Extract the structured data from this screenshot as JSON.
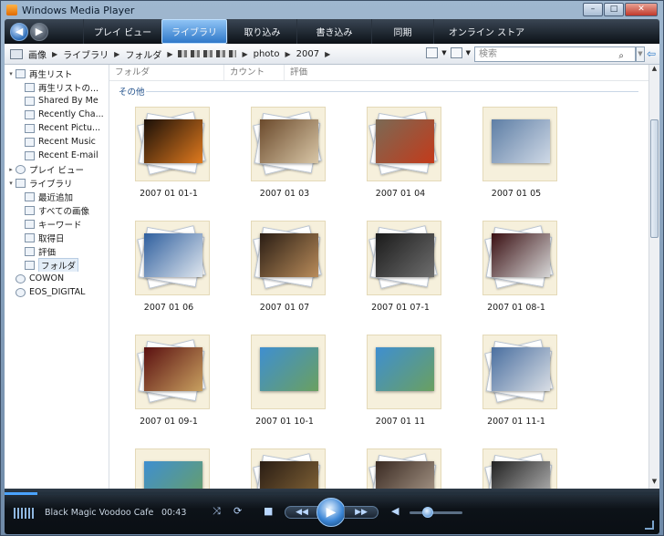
{
  "window": {
    "title": "Windows Media Player",
    "min": "–",
    "max": "□",
    "close": "✕"
  },
  "nav": {
    "back": "◀",
    "forward": "▶",
    "tabs": [
      {
        "label": "プレイ ビュー",
        "active": false
      },
      {
        "label": "ライブラリ",
        "active": true
      },
      {
        "label": "取り込み",
        "active": false
      },
      {
        "label": "書き込み",
        "active": false
      },
      {
        "label": "同期",
        "active": false
      },
      {
        "label": "オンライン ストア",
        "active": false
      }
    ]
  },
  "address": {
    "crumbs": [
      "画像",
      "ライブラリ",
      "フォルダ",
      "photo",
      "2007"
    ],
    "sep": "▶",
    "search_placeholder": "検索",
    "search_icon": "search-icon",
    "view_dd": "▼",
    "back_icon": "⇦"
  },
  "tree": [
    {
      "label": "再生リスト",
      "level": 0,
      "exp": "▾",
      "icon": "playlist-icon"
    },
    {
      "label": "再生リストの...",
      "level": 1,
      "icon": "playlist-item-icon"
    },
    {
      "label": "Shared By Me",
      "level": 1,
      "icon": "playlist-item-icon"
    },
    {
      "label": "Recently Cha...",
      "level": 1,
      "icon": "playlist-item-icon"
    },
    {
      "label": "Recent Pictu...",
      "level": 1,
      "icon": "playlist-item-icon"
    },
    {
      "label": "Recent Music",
      "level": 1,
      "icon": "playlist-item-icon"
    },
    {
      "label": "Recent E-mail",
      "level": 1,
      "icon": "playlist-item-icon"
    },
    {
      "label": "プレイ ビュー",
      "level": 0,
      "exp": "▸",
      "icon": "now-playing-icon"
    },
    {
      "label": "ライブラリ",
      "level": 0,
      "exp": "▾",
      "icon": "library-icon"
    },
    {
      "label": "最近追加",
      "level": 1,
      "icon": "recently-added-icon"
    },
    {
      "label": "すべての画像",
      "level": 1,
      "icon": "all-pictures-icon"
    },
    {
      "label": "キーワード",
      "level": 1,
      "icon": "keywords-icon"
    },
    {
      "label": "取得日",
      "level": 1,
      "icon": "date-taken-icon"
    },
    {
      "label": "評価",
      "level": 1,
      "icon": "rating-icon"
    },
    {
      "label": "フォルダ",
      "level": 1,
      "icon": "folder-icon",
      "selected": true
    },
    {
      "label": "COWON",
      "level": 0,
      "icon": "device-icon"
    },
    {
      "label": "EOS_DIGITAL",
      "level": 0,
      "icon": "device-icon"
    }
  ],
  "columns": [
    "フォルダ",
    "カウント",
    "評価"
  ],
  "group_label": "その他",
  "items": [
    {
      "caption": "2007 01 01-1",
      "photo": [
        "#1a0f08",
        "#e07a1e"
      ],
      "kind": "stack"
    },
    {
      "caption": "2007 01 03",
      "photo": [
        "#6b4a2c",
        "#d8c6a6"
      ],
      "kind": "stack"
    },
    {
      "caption": "2007 01 04",
      "photo": [
        "#7a6a55",
        "#c43a1a"
      ],
      "kind": "stack"
    },
    {
      "caption": "2007 01 05",
      "photo": [
        "#5e7ea5",
        "#cfd9e6"
      ],
      "kind": "single"
    },
    {
      "caption": "2007 01 06",
      "photo": [
        "#2f5f9e",
        "#dfe6ee"
      ],
      "kind": "stack"
    },
    {
      "caption": "2007 01 07",
      "photo": [
        "#2a1d14",
        "#b98c5a"
      ],
      "kind": "stack"
    },
    {
      "caption": "2007 01 07-1",
      "photo": [
        "#1a1a1a",
        "#6e6e6e"
      ],
      "kind": "stack"
    },
    {
      "caption": "2007 01 08-1",
      "photo": [
        "#3a0f12",
        "#d6d6d6"
      ],
      "kind": "stack"
    },
    {
      "caption": "2007 01 09-1",
      "photo": [
        "#5a1010",
        "#c8a060"
      ],
      "kind": "stack"
    },
    {
      "caption": "2007 01 10-1",
      "photo": [
        "#3f8fd0",
        "#6aa060"
      ],
      "kind": "single"
    },
    {
      "caption": "2007 01 11",
      "photo": [
        "#3f8fd0",
        "#6aa060"
      ],
      "kind": "single"
    },
    {
      "caption": "2007 01 11-1",
      "photo": [
        "#4a6fa0",
        "#d8dde4"
      ],
      "kind": "stack"
    },
    {
      "caption": "",
      "photo": [
        "#3f8fd0",
        "#6aa060"
      ],
      "kind": "single"
    },
    {
      "caption": "",
      "photo": [
        "#2a1d14",
        "#8a6a3a"
      ],
      "kind": "stack"
    },
    {
      "caption": "",
      "photo": [
        "#3a2a22",
        "#b0a090"
      ],
      "kind": "stack"
    },
    {
      "caption": "",
      "photo": [
        "#222",
        "#bdbdbd"
      ],
      "kind": "stack"
    }
  ],
  "player": {
    "track": "Black Magic Voodoo Cafe",
    "time": "00:43",
    "progress": 0.05,
    "shuffle": "⤨",
    "repeat": "⟳",
    "stop": "■",
    "prev": "◀◀",
    "play": "▶",
    "next": "▶▶",
    "volume_icon": "◀",
    "volume_level": 0.35
  }
}
